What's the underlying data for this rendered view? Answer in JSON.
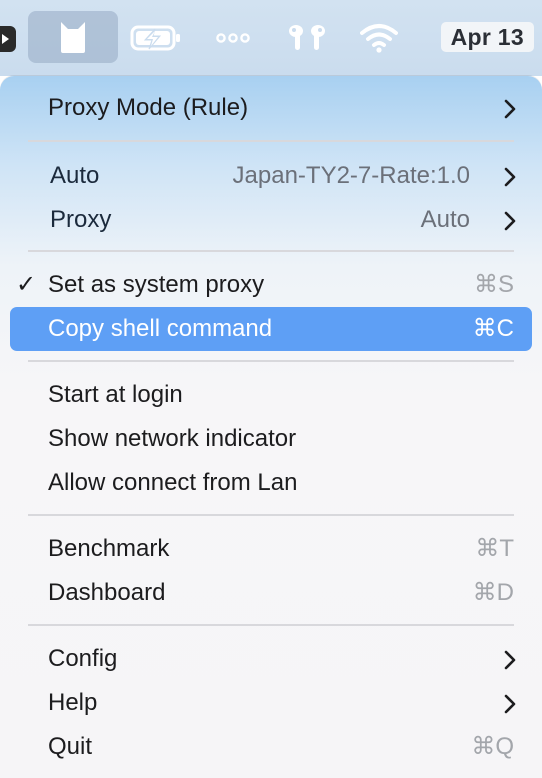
{
  "menubar": {
    "date": "Apr 13",
    "icons": [
      "clashx-cat-icon",
      "battery-charging-icon",
      "more-dots-icon",
      "airpods-icon",
      "wifi-icon"
    ]
  },
  "menu": {
    "proxy_mode": {
      "label": "Proxy Mode (Rule)"
    },
    "auto": {
      "label": "Auto",
      "value": "Japan-TY2-7-Rate:1.0"
    },
    "proxy": {
      "label": "Proxy",
      "value": "Auto"
    },
    "set_system_proxy": {
      "label": "Set as system proxy",
      "shortcut": "⌘S",
      "checked": "✓"
    },
    "copy_shell": {
      "label": "Copy shell command",
      "shortcut": "⌘C"
    },
    "start_login": {
      "label": "Start at login"
    },
    "network_indicator": {
      "label": "Show network indicator"
    },
    "allow_lan": {
      "label": "Allow connect from Lan"
    },
    "benchmark": {
      "label": "Benchmark",
      "shortcut": "⌘T"
    },
    "dashboard": {
      "label": "Dashboard",
      "shortcut": "⌘D"
    },
    "config": {
      "label": "Config"
    },
    "help": {
      "label": "Help"
    },
    "quit": {
      "label": "Quit",
      "shortcut": "⌘Q"
    }
  },
  "colors": {
    "highlight": "#5e9ff5",
    "shortcut_gray": "#a3a6ab",
    "value_gray": "#6b7079"
  }
}
